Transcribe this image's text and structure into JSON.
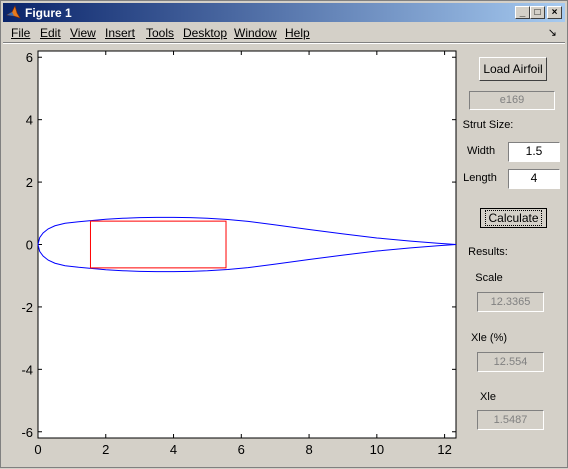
{
  "window": {
    "title": "Figure 1",
    "controls": {
      "minimize": "_",
      "maximize": "□",
      "close": "×"
    },
    "title_icon": "matlab-logo-icon"
  },
  "menu": {
    "items": [
      {
        "key": "file",
        "label": "File"
      },
      {
        "key": "edit",
        "label": "Edit"
      },
      {
        "key": "view",
        "label": "View"
      },
      {
        "key": "insert",
        "label": "Insert"
      },
      {
        "key": "tools",
        "label": "Tools"
      },
      {
        "key": "desktop",
        "label": "Desktop"
      },
      {
        "key": "window",
        "label": "Window"
      },
      {
        "key": "help",
        "label": "Help"
      }
    ],
    "dock_icon": "↘"
  },
  "panel": {
    "load_button": "Load Airfoil",
    "airfoil_name": "e169",
    "strut_size_label": "Strut Size:",
    "width_label": "Width",
    "width_value": "1.5",
    "length_label": "Length",
    "length_value": "4",
    "calculate_button": "Calculate",
    "results_label": "Results:",
    "scale_label": "Scale",
    "scale_value": "12.3365",
    "xle_pct_label": "Xle (%)",
    "xle_pct_value": "12.554",
    "xle_label": "Xle",
    "xle_value": "1.5487"
  },
  "colors": {
    "airfoil": "#0000ff",
    "strut": "#ff0000",
    "titlebar_start": "#0a246a",
    "titlebar_end": "#a6caf0"
  },
  "chart_data": {
    "type": "line",
    "title": "",
    "xlabel": "",
    "ylabel": "",
    "xlim": [
      0,
      12.3365
    ],
    "ylim": [
      -6.2,
      6.2
    ],
    "xticks": [
      0,
      2,
      4,
      6,
      8,
      10,
      12
    ],
    "yticks": [
      -6,
      -4,
      -2,
      0,
      2,
      4,
      6
    ],
    "grid": false,
    "series": [
      {
        "role": "airfoil",
        "x": [
          0,
          0.05,
          0.15,
          0.3,
          0.5,
          0.8,
          1.2,
          1.6,
          2.0,
          2.5,
          3.0,
          3.5,
          4.0,
          4.5,
          5.0,
          5.6,
          6.2,
          7.0,
          8.0,
          9.0,
          10.0,
          11.0,
          11.8,
          12.3365,
          11.8,
          11.0,
          10.0,
          9.0,
          8.0,
          7.0,
          6.2,
          5.6,
          5.0,
          4.5,
          4.0,
          3.5,
          3.0,
          2.5,
          2.0,
          1.6,
          1.2,
          0.8,
          0.5,
          0.3,
          0.15,
          0.05,
          0
        ],
        "y": [
          0,
          0.22,
          0.37,
          0.5,
          0.6,
          0.68,
          0.73,
          0.77,
          0.81,
          0.84,
          0.86,
          0.87,
          0.87,
          0.86,
          0.84,
          0.8,
          0.74,
          0.63,
          0.48,
          0.34,
          0.21,
          0.11,
          0.04,
          0,
          -0.04,
          -0.11,
          -0.21,
          -0.34,
          -0.48,
          -0.63,
          -0.74,
          -0.8,
          -0.84,
          -0.86,
          -0.87,
          -0.87,
          -0.86,
          -0.84,
          -0.81,
          -0.77,
          -0.73,
          -0.68,
          -0.6,
          -0.5,
          -0.37,
          -0.22,
          0
        ]
      },
      {
        "role": "strut",
        "x": [
          1.5487,
          5.5487,
          5.5487,
          1.5487,
          1.5487
        ],
        "y": [
          0.75,
          0.75,
          -0.75,
          -0.75,
          0.75
        ]
      }
    ]
  }
}
